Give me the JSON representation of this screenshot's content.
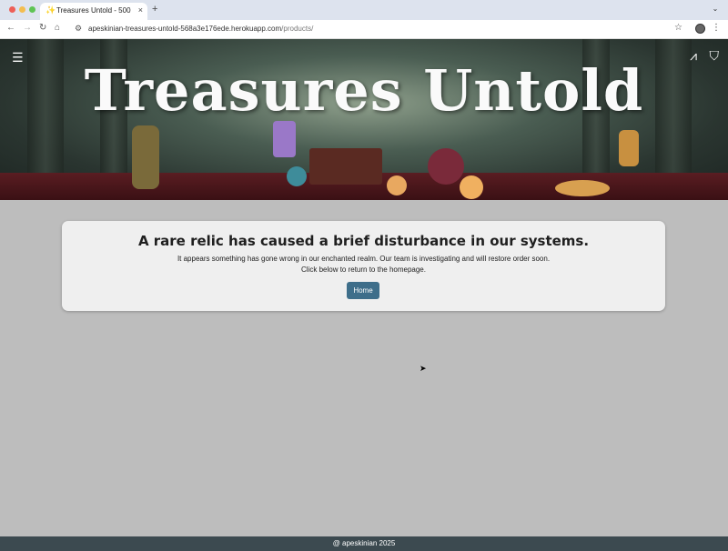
{
  "browser": {
    "tab_title": "Treasures Untold - 500",
    "tab_favicon": "✨",
    "tab_close": "×",
    "new_tab": "+",
    "url_host": "apeskinian-treasures-untold-568a3e176ede.herokuapp.com",
    "url_path": "/products/"
  },
  "site": {
    "title": "Treasures Untold",
    "menu_icon": "menu-icon",
    "account_icon": "wizard-hat-icon",
    "basket_icon": "basket-icon"
  },
  "error": {
    "heading": "A rare relic has caused a brief disturbance in our systems.",
    "line1": "It appears something has gone wrong in our enchanted realm. Our team is investigating and will restore order soon.",
    "line2": "Click below to return to the homepage.",
    "button_label": "Home"
  },
  "footer": {
    "text": "@ apeskinian 2025"
  },
  "colors": {
    "button": "#3e6e8a",
    "footer_bg": "#3c4a50",
    "page_bg": "#bdbdbd"
  }
}
